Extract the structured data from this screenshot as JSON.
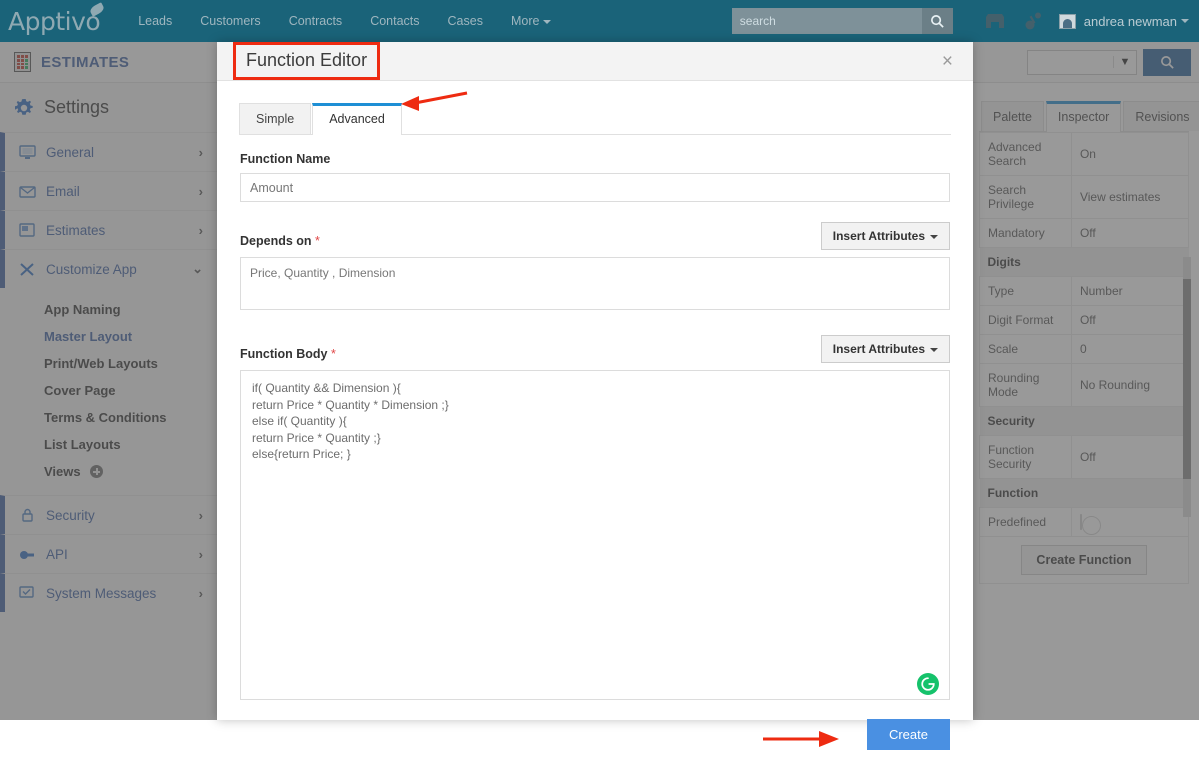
{
  "topnav": {
    "brand": "Apptivo",
    "links": [
      {
        "label": "Leads"
      },
      {
        "label": "Customers"
      },
      {
        "label": "Contracts"
      },
      {
        "label": "Contacts"
      },
      {
        "label": "Cases"
      },
      {
        "label": "More"
      }
    ],
    "search_placeholder": "search",
    "search_value": "",
    "search_icon": "search-icon",
    "store_icon": "store-icon",
    "connect_icon": "connect-icon",
    "user_name": "andrea newman",
    "bg_color": "#1a6379"
  },
  "sidebar": {
    "app_title": "ESTIMATES",
    "app_icon": "calculator-icon",
    "settings_label": "Settings",
    "settings_icon": "gear-icon",
    "groups": [
      {
        "label": "General",
        "icon": "monitor-icon",
        "arrow": "›"
      },
      {
        "label": "Email",
        "icon": "envelope-icon",
        "arrow": "›"
      },
      {
        "label": "Estimates",
        "icon": "document-icon",
        "arrow": "›"
      },
      {
        "label": "Customize App",
        "icon": "tools-icon",
        "arrow": "⌄"
      }
    ],
    "sub_items": [
      {
        "label": "App Naming",
        "active": false
      },
      {
        "label": "Master Layout",
        "active": true
      },
      {
        "label": "Print/Web Layouts",
        "active": false
      },
      {
        "label": "Cover Page",
        "active": false
      },
      {
        "label": "Terms & Conditions",
        "active": false
      },
      {
        "label": "List Layouts",
        "active": false
      },
      {
        "label": "Views",
        "active": false,
        "has_plus": true
      }
    ],
    "groups_bottom": [
      {
        "label": "Security",
        "icon": "lock-icon",
        "arrow": "›"
      },
      {
        "label": "API",
        "icon": "plug-icon",
        "arrow": "›"
      },
      {
        "label": "System Messages",
        "icon": "message-icon",
        "arrow": "›"
      }
    ]
  },
  "right_panel": {
    "search_value": "",
    "search_button_icon": "search-icon",
    "dropdown_icon": "chevron-down-icon",
    "tabs": [
      {
        "label": "Palette",
        "active": false
      },
      {
        "label": "Inspector",
        "active": true
      },
      {
        "label": "Revisions",
        "active": false
      }
    ],
    "properties": [
      {
        "type": "row",
        "key": "Advanced Search",
        "value": "On"
      },
      {
        "type": "row",
        "key": "Search Privilege",
        "value": "View estimates"
      },
      {
        "type": "row",
        "key": "Mandatory",
        "value": "Off"
      },
      {
        "type": "section",
        "key": "Digits"
      },
      {
        "type": "row",
        "key": "Type",
        "value": "Number"
      },
      {
        "type": "row",
        "key": "Digit Format",
        "value": "Off"
      },
      {
        "type": "row",
        "key": "Scale",
        "value": "0"
      },
      {
        "type": "row",
        "key": "Rounding Mode",
        "value": "No Rounding"
      },
      {
        "type": "section",
        "key": "Security"
      },
      {
        "type": "row",
        "key": "Function Security",
        "value": "Off"
      },
      {
        "type": "section",
        "key": "Function"
      },
      {
        "type": "toggle",
        "key": "Predefined",
        "value": "off"
      }
    ],
    "create_function_label": "Create Function"
  },
  "modal": {
    "title": "Function Editor",
    "title_highlight_color": "#ee2b11",
    "close_label": "×",
    "tabs": [
      {
        "label": "Simple",
        "active": false
      },
      {
        "label": "Advanced",
        "active": true
      }
    ],
    "fields": {
      "function_name_label": "Function Name",
      "function_name_value": "Amount",
      "function_name_placeholder": "",
      "depends_on_label": "Depends on",
      "depends_on_required": "*",
      "depends_on_value": "Price, Quantity , Dimension",
      "function_body_label": "Function Body",
      "function_body_required": "*",
      "function_body_value": "if( Quantity && Dimension ){\nreturn Price * Quantity * Dimension ;}\nelse if( Quantity ){\nreturn Price * Quantity ;}\nelse{return Price; }",
      "insert_attributes_label": "Insert Attributes"
    },
    "grammarly_icon": "grammarly-icon",
    "create_button_label": "Create",
    "create_button_color": "#4a90e2",
    "annotation_arrow_color": "#ee2b11"
  }
}
